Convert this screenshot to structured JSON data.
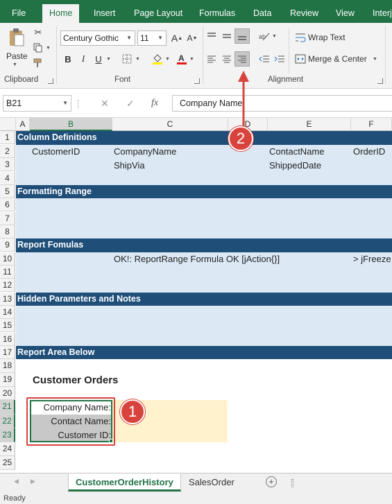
{
  "ribbon": {
    "tabs": [
      {
        "label": "File",
        "active": false
      },
      {
        "label": "Home",
        "active": true
      },
      {
        "label": "Insert",
        "active": false
      },
      {
        "label": "Page Layout",
        "active": false
      },
      {
        "label": "Formulas",
        "active": false
      },
      {
        "label": "Data",
        "active": false
      },
      {
        "label": "Review",
        "active": false
      },
      {
        "label": "View",
        "active": false
      },
      {
        "label": "Interj",
        "active": false
      }
    ],
    "clipboard": {
      "label": "Clipboard",
      "paste_label": "Paste"
    },
    "font": {
      "label": "Font",
      "family": "Century Gothic",
      "size": "11"
    },
    "alignment": {
      "label": "Alignment",
      "wrap_text": "Wrap Text",
      "merge_center": "Merge & Center"
    }
  },
  "formula_bar": {
    "name_box": "B21",
    "fx": "fx",
    "content": "Company Name:"
  },
  "grid": {
    "columns": [
      "A",
      "B",
      "C",
      "D",
      "E",
      "F"
    ],
    "selected_column": "B",
    "rows": [
      "1",
      "2",
      "3",
      "4",
      "5",
      "6",
      "7",
      "8",
      "9",
      "10",
      "11",
      "12",
      "13",
      "14",
      "15",
      "16",
      "17",
      "18",
      "19",
      "20",
      "21",
      "22",
      "23",
      "24",
      "25"
    ],
    "selected_rows": [
      "21",
      "22",
      "23"
    ],
    "bands": {
      "r1": "Column Definitions",
      "r5": "Formatting Range",
      "r9": "Report Fomulas",
      "r13": "Hidden Parameters and Notes",
      "r17": "Report Area Below"
    },
    "cells": {
      "b2": "CustomerID",
      "c2": "CompanyName",
      "e2": "ContactName",
      "f2": "OrderID",
      "c3": "ShipVia",
      "e3": "ShippedDate",
      "c10": "OK!: ReportRange Formula OK [jAction{}]",
      "f10": "> jFreeze",
      "b19": "Customer Orders",
      "b21": "Company Name:",
      "b22": "Contact Name:",
      "b23": "Customer ID:"
    }
  },
  "sheets": {
    "tabs": [
      "CustomerOrderHistory",
      "SalesOrder"
    ],
    "active": "CustomerOrderHistory",
    "add_icon": "+"
  },
  "status": {
    "text": "Ready"
  },
  "callouts": {
    "one": "1",
    "two": "2"
  },
  "colors": {
    "excel_green": "#217346",
    "band_blue": "#1f4e79",
    "light_blue": "#dce9f5",
    "callout_red": "#d9433d",
    "input_yellow": "#fff2cc"
  }
}
